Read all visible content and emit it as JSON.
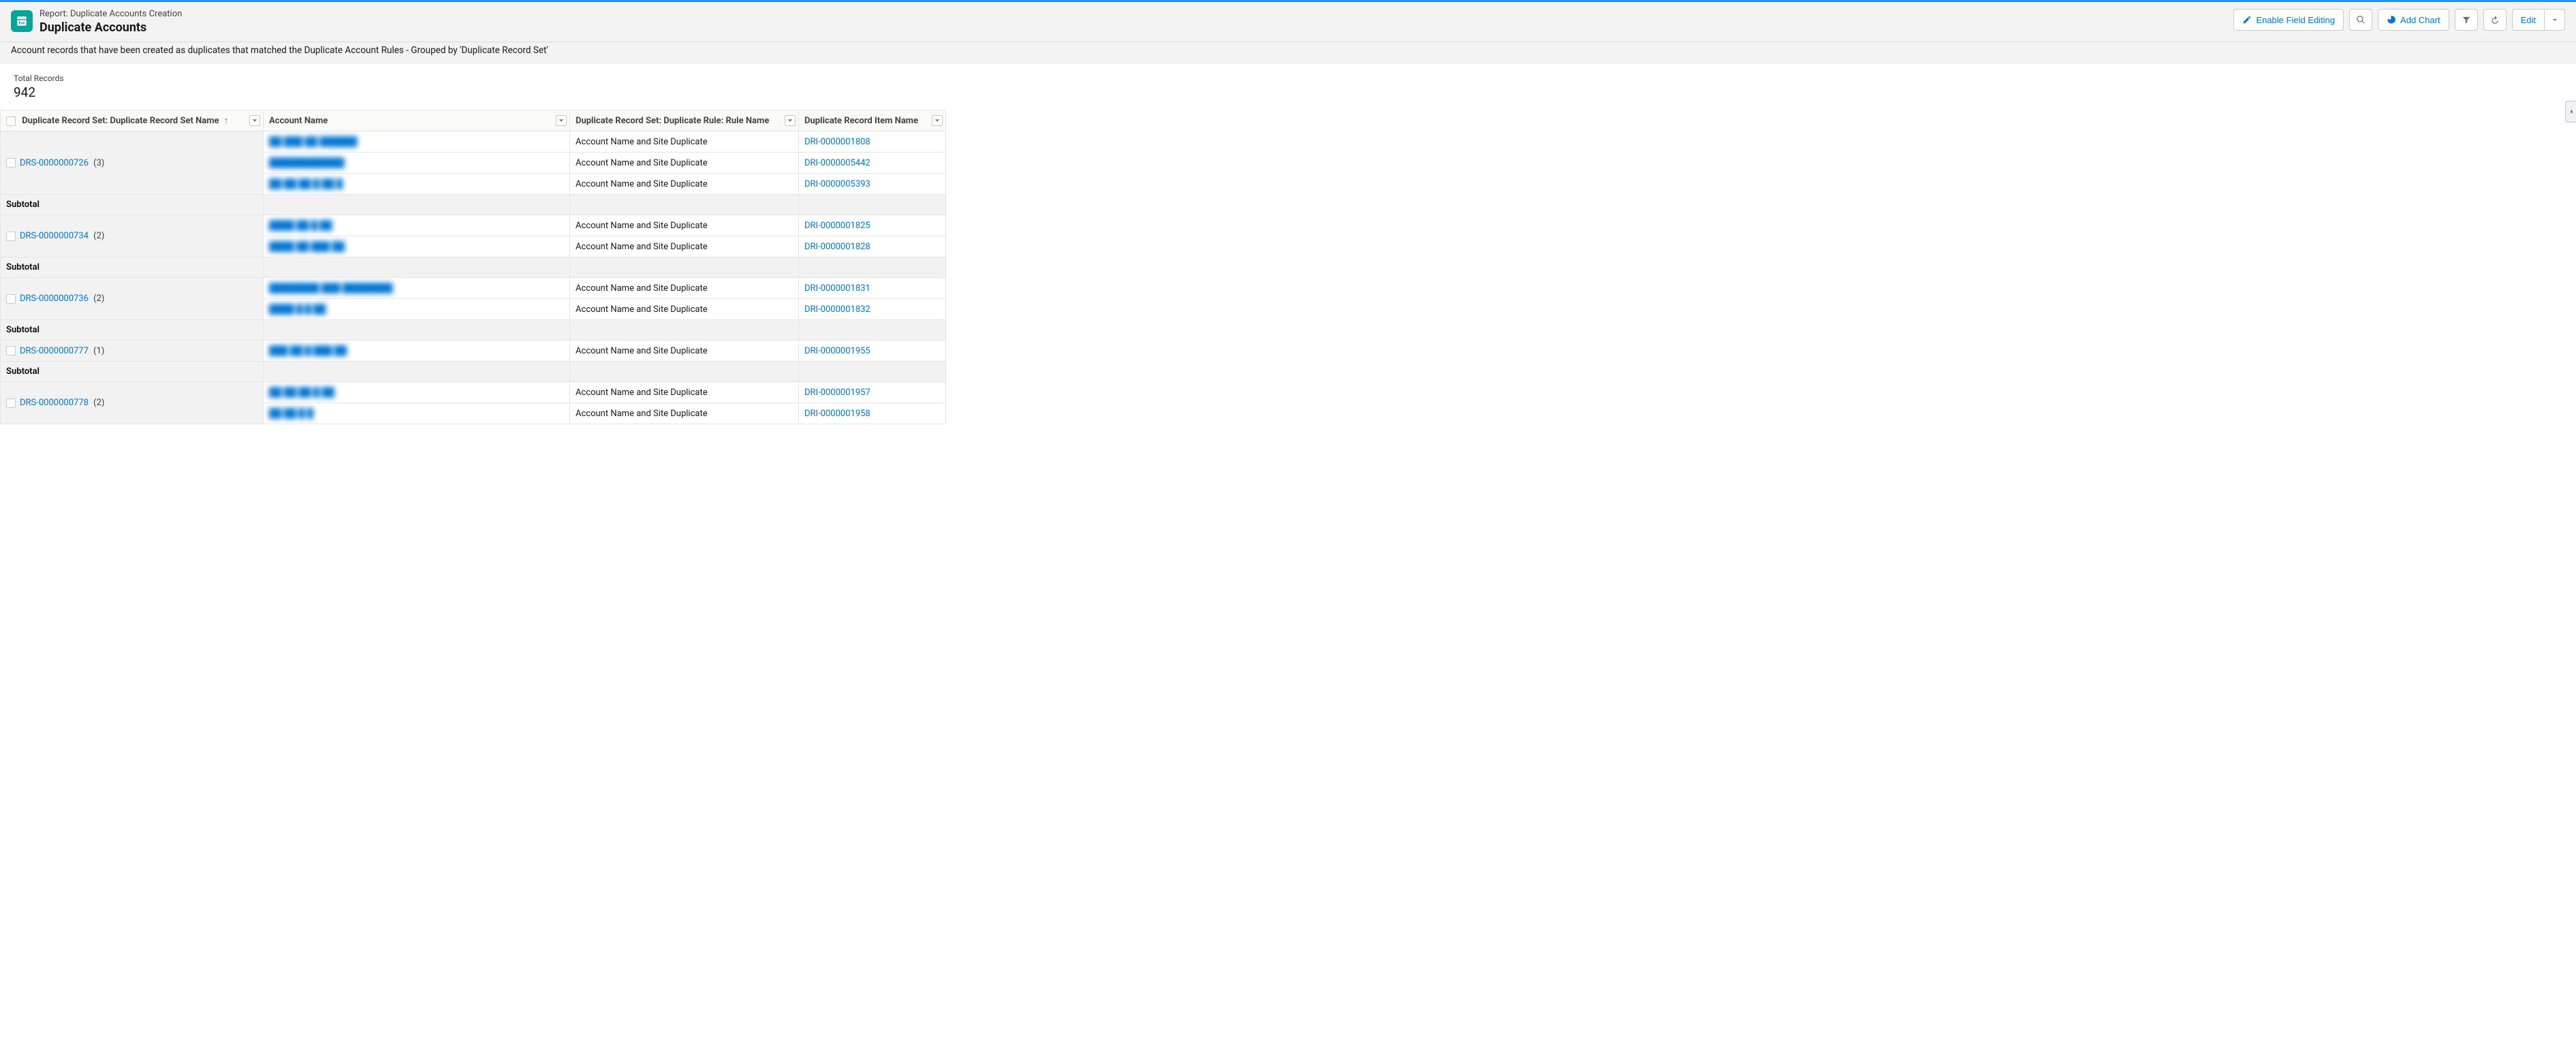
{
  "header": {
    "eyebrow": "Report: Duplicate Accounts Creation",
    "title": "Duplicate Accounts",
    "description": "Account records that have been created as duplicates that matched the Duplicate Account Rules - Grouped by 'Duplicate Record Set'"
  },
  "toolbar": {
    "enable_field_editing": "Enable Field Editing",
    "add_chart": "Add Chart",
    "edit": "Edit"
  },
  "summary": {
    "total_records_label": "Total Records",
    "total_records_value": "942"
  },
  "columns": {
    "drs_name": "Duplicate Record Set: Duplicate Record Set Name",
    "account_name": "Account Name",
    "rule_name": "Duplicate Record Set: Duplicate Rule: Rule Name",
    "dri_name": "Duplicate Record Item Name"
  },
  "subtotal_label": "Subtotal",
  "groups": [
    {
      "drs": "DRS-0000000726",
      "count": "(3)",
      "rows": [
        {
          "account": "██ ███ ██ ██████",
          "rule": "Account Name and Site Duplicate",
          "dri": "DRI-0000001808"
        },
        {
          "account": "████████████",
          "rule": "Account Name and Site Duplicate",
          "dri": "DRI-0000005442"
        },
        {
          "account": "██ ██ ██ █ ██ █",
          "rule": "Account Name and Site Duplicate",
          "dri": "DRI-0000005393"
        }
      ]
    },
    {
      "drs": "DRS-0000000734",
      "count": "(2)",
      "rows": [
        {
          "account": "████ ██  █ ██",
          "rule": "Account Name and Site Duplicate",
          "dri": "DRI-0000001825"
        },
        {
          "account": "████ ██ ███ ██",
          "rule": "Account Name and Site Duplicate",
          "dri": "DRI-0000001828"
        }
      ]
    },
    {
      "drs": "DRS-0000000736",
      "count": "(2)",
      "rows": [
        {
          "account": "████████  ███ ████████",
          "rule": "Account Name and Site Duplicate",
          "dri": "DRI-0000001831"
        },
        {
          "account": "████ █ █ ██",
          "rule": "Account Name and Site Duplicate",
          "dri": "DRI-0000001832"
        }
      ]
    },
    {
      "drs": "DRS-0000000777",
      "count": "(1)",
      "rows": [
        {
          "account": "███ ██ █ ███ ██",
          "rule": "Account Name and Site Duplicate",
          "dri": "DRI-0000001955"
        }
      ]
    },
    {
      "drs": "DRS-0000000778",
      "count": "(2)",
      "rows": [
        {
          "account": "██ ██ ██ █ ██",
          "rule": "Account Name and Site Duplicate",
          "dri": "DRI-0000001957"
        },
        {
          "account": "██ ██ █ █",
          "rule": "Account Name and Site Duplicate",
          "dri": "DRI-0000001958"
        }
      ]
    }
  ]
}
